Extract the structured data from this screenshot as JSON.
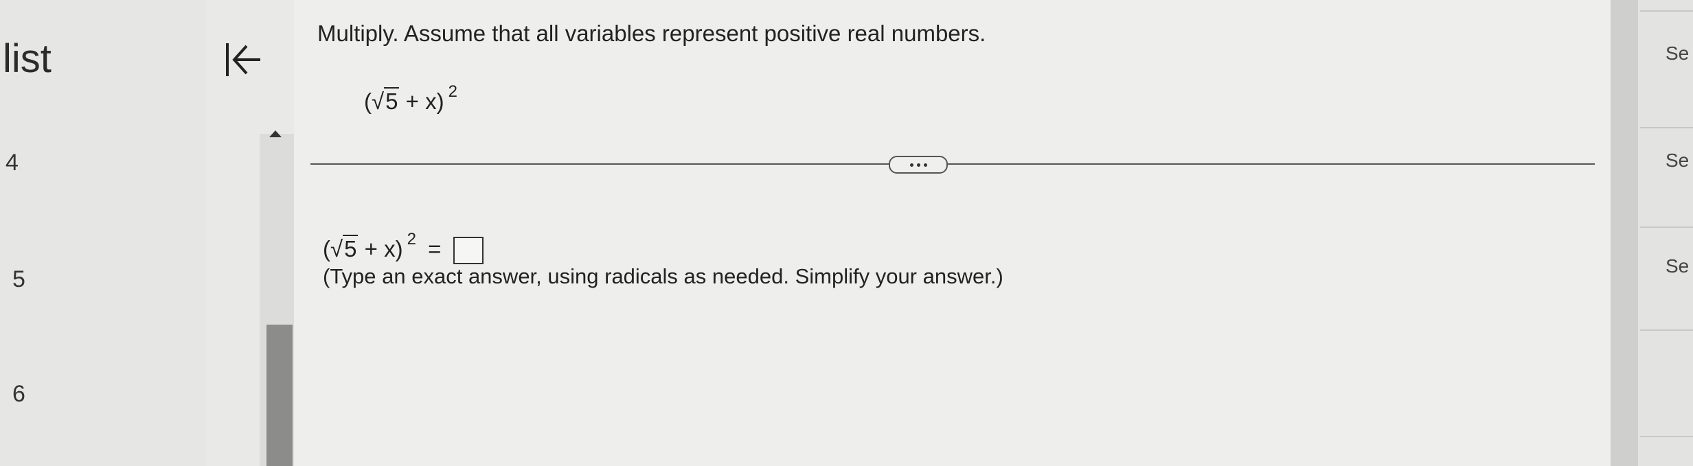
{
  "sidebar": {
    "title": "list",
    "items": [
      {
        "label": "4"
      },
      {
        "label": "5"
      },
      {
        "label": "6"
      }
    ]
  },
  "question": {
    "instruction": "Multiply. Assume that all variables represent positive real numbers.",
    "expression": {
      "open": "(",
      "radicand": "5",
      "rest": " + x)",
      "exponent": "2"
    },
    "answer_equals": "=",
    "hint": "(Type an exact answer, using radicals as needed. Simplify your answer.)"
  },
  "right_panel": {
    "items": [
      {
        "label": "Se"
      },
      {
        "label": "Se"
      },
      {
        "label": "Se"
      }
    ]
  },
  "icons": {
    "collapse": "collapse-left-arrow-icon",
    "more": "more-dots-icon",
    "scroll_up": "scroll-up-arrow-icon"
  },
  "colors": {
    "background": "#eeeeec",
    "text": "#222222",
    "scroll_thumb": "#8c8c8a"
  }
}
